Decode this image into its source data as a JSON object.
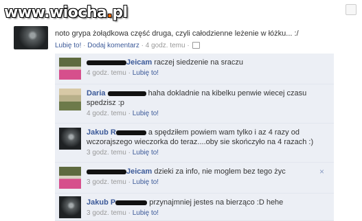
{
  "watermark": {
    "prefix": "www.",
    "brand": "wiocha",
    "dot": ".",
    "tld": "pl"
  },
  "post": {
    "text": "noto grypa żołądkowa część druga, czyli całodzienne leżenie w łóżku... :/",
    "like": "Lubię to!",
    "sep1": " · ",
    "comment": "Dodaj komentarz",
    "sep2": " · ",
    "time": "4 godz. temu",
    "sep3": " · "
  },
  "comments": [
    {
      "name": "Jeicam",
      "text": "raczej siedzenie na sraczu",
      "time": "4 godz. temu",
      "sep": " · ",
      "like": "Lubię to!"
    },
    {
      "name": "Daria",
      "text": "haha dokladnie na kibelku penwie wiecej czasu spedzisz :p",
      "time": "4 godz. temu",
      "sep": " · ",
      "like": "Lubię to!"
    },
    {
      "name": "Jakub R",
      "text": "a spędziłem powiem wam tylko i az 4 razy od wczorajszego wieczorka do teraz....oby sie skończyło na 4 razach :)",
      "time": "3 godz. temu",
      "sep": " · ",
      "like": "Lubię to!"
    },
    {
      "name": "Jeicam",
      "text": "dzieki za info, nie moglem bez tego życ",
      "time": "3 godz. temu",
      "sep": " · ",
      "like": "Lubię to!",
      "close": "×"
    },
    {
      "name": "Jakub P",
      "text": "przynajmniej jestes na bierząco :D hehe",
      "time": "3 godz. temu",
      "sep": " · ",
      "like": "Lubię to!"
    }
  ]
}
